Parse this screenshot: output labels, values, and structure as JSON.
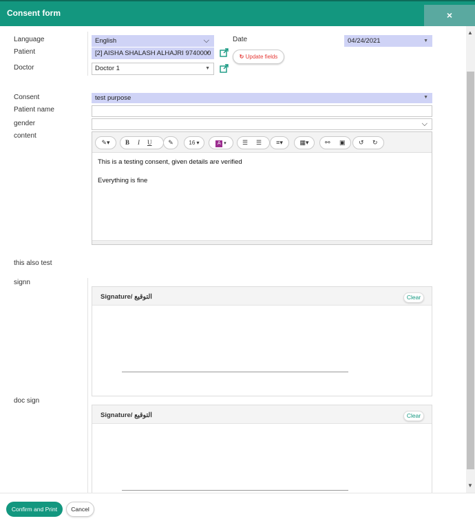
{
  "header": {
    "title": "Consent form",
    "close_glyph": "×"
  },
  "form": {
    "language": {
      "label": "Language",
      "value": "English"
    },
    "date": {
      "label": "Date",
      "value": "04/24/2021"
    },
    "patient": {
      "label": "Patient",
      "value": "[2] AISHA SHALASH ALHAJRI 9740000"
    },
    "update_fields_label": "Update fields",
    "doctor": {
      "label": "Doctor",
      "value": "Doctor 1"
    },
    "consent": {
      "label": "Consent",
      "value": "test purpose"
    },
    "patient_name": {
      "label": "Patient name",
      "value": ""
    },
    "gender": {
      "label": "gender",
      "value": ""
    },
    "content": {
      "label": "content",
      "font_size": "16",
      "lines": [
        "This is a testing consent, given details are verified",
        "Everything is  fine"
      ]
    },
    "extra_label": "this also test",
    "signatures": [
      {
        "label": "signn",
        "title": "Signature/ التوقيع",
        "clear_label": "Clear"
      },
      {
        "label": "doc sign",
        "title": "Signature/ التوقيع",
        "clear_label": "Clear"
      }
    ]
  },
  "footer": {
    "confirm_label": "Confirm and Print",
    "cancel_label": "Cancel"
  },
  "colors": {
    "primary": "#13977f",
    "select_fill": "#cfd3f6"
  },
  "icons": [
    "external-link-icon",
    "refresh-icon",
    "close-icon"
  ]
}
